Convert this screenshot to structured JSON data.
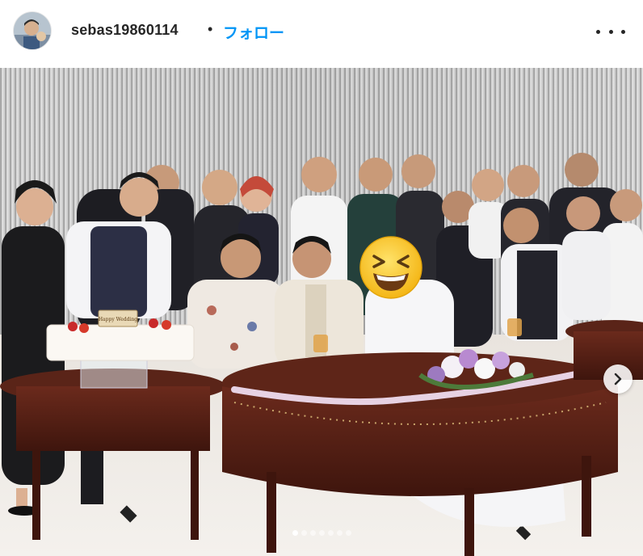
{
  "post_header": {
    "username": "sebas19860114",
    "separator": "•",
    "follow_label": "フォロー",
    "more_icon": "more-horizontal-icon"
  },
  "photo": {
    "description_alt": "",
    "emoji_sticker": "grinning-squinting-face",
    "cake_plaque_text": "Happy Wedding"
  },
  "carousel": {
    "slide_count": 7,
    "active_index": 0,
    "next_icon": "chevron-right-icon"
  },
  "colors": {
    "follow_blue": "#0095f6",
    "text_dark": "#262626",
    "table_wood": "#5a2418"
  }
}
